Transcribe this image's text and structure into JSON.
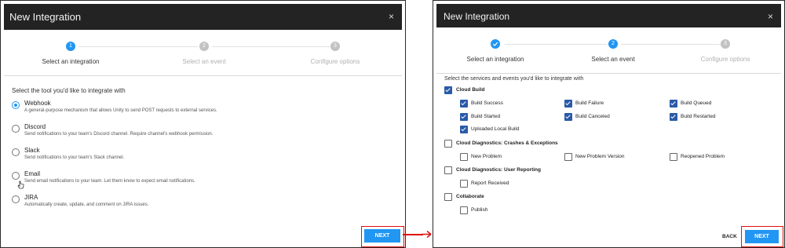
{
  "left": {
    "title": "New Integration",
    "close": "×",
    "steps": [
      {
        "num": "1",
        "label": "Select an integration",
        "state": "active"
      },
      {
        "num": "2",
        "label": "Select an event",
        "state": "pending"
      },
      {
        "num": "3",
        "label": "Configure options",
        "state": "pending"
      }
    ],
    "prompt": "Select the tool you'd like to integrate with",
    "options": [
      {
        "name": "Webhook",
        "desc": "A general-purpose mechanism that allows Unity to send POST requests to external services.",
        "selected": true
      },
      {
        "name": "Discord",
        "desc": "Send notifications to your team's Discord channel. Require channel's webhook permission.",
        "selected": false
      },
      {
        "name": "Slack",
        "desc": "Send notifications to your team's Slack channel.",
        "selected": false
      },
      {
        "name": "Email",
        "desc": "Send email notifications to your team. Let them know to expect email notifications.",
        "selected": false
      },
      {
        "name": "JIRA",
        "desc": "Automatically create, update, and comment on JIRA issues.",
        "selected": false
      }
    ],
    "next": "NEXT"
  },
  "right": {
    "title": "New Integration",
    "close": "×",
    "steps": [
      {
        "num": "",
        "label": "Select an integration",
        "state": "done"
      },
      {
        "num": "2",
        "label": "Select an event",
        "state": "active"
      },
      {
        "num": "3",
        "label": "Configure options",
        "state": "pending"
      }
    ],
    "prompt": "Select the services and events you'd like to integrate with",
    "groups": [
      {
        "name": "Cloud Build",
        "checked": true,
        "events": [
          {
            "label": "Build Success",
            "checked": true
          },
          {
            "label": "Build Failure",
            "checked": true
          },
          {
            "label": "Build Queued",
            "checked": true
          },
          {
            "label": "Build Started",
            "checked": true
          },
          {
            "label": "Build Canceled",
            "checked": true
          },
          {
            "label": "Build Restarted",
            "checked": true
          },
          {
            "label": "Uploaded Local Build",
            "checked": true
          }
        ]
      },
      {
        "name": "Cloud Diagnostics: Crashes & Exceptions",
        "checked": false,
        "events": [
          {
            "label": "New Problem",
            "checked": false
          },
          {
            "label": "New Problem Version",
            "checked": false
          },
          {
            "label": "Reopened Problem",
            "checked": false
          }
        ]
      },
      {
        "name": "Cloud Diagnostics: User Reporting",
        "checked": false,
        "events": [
          {
            "label": "Report Received",
            "checked": false
          }
        ]
      },
      {
        "name": "Collaborate",
        "checked": false,
        "events": [
          {
            "label": "Publish",
            "checked": false
          }
        ]
      }
    ],
    "back": "BACK",
    "next": "NEXT"
  },
  "colors": {
    "accent": "#2196f3",
    "highlight": "#e01010",
    "titlebar": "#232323",
    "checkbox": "#2a5aa8"
  }
}
